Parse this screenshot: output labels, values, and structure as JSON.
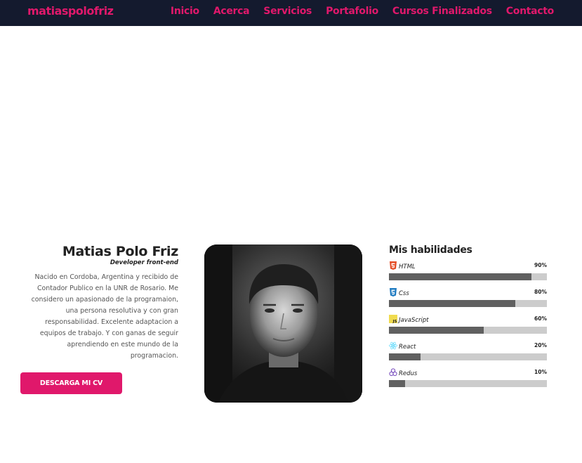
{
  "nav": {
    "brand": "matiaspolofriz",
    "links": [
      "Inicio",
      "Acerca",
      "Servicios",
      "Portafolio",
      "Cursos Finalizados",
      "Contacto"
    ]
  },
  "about": {
    "name": "Matias Polo Friz",
    "role": "Developer front-end",
    "bio": "Nacido en Cordoba, Argentina y recibido de Contador Publico en la UNR de Rosario. Me considero un apasionado de la programaion, una persona resolutiva y con gran responsabilidad. Excelente adaptacion a equipos de trabajo. Y con ganas de seguir aprendiendo en este mundo de la programacion.",
    "cv_button": "DESCARGA MI CV"
  },
  "skills": {
    "title": "Mis habilidades",
    "items": [
      {
        "name": "HTML",
        "percent": "90%",
        "value": 0.9,
        "icon": "html5-icon",
        "color": "#e44d26"
      },
      {
        "name": "Css",
        "percent": "80%",
        "value": 0.8,
        "icon": "css3-icon",
        "color": "#1f7bc1"
      },
      {
        "name": "JavaScript",
        "percent": "60%",
        "value": 0.6,
        "icon": "javascript-icon",
        "color": "#f0db4f"
      },
      {
        "name": "React",
        "percent": "20%",
        "value": 0.2,
        "icon": "react-icon",
        "color": "#61dafb"
      },
      {
        "name": "Redus",
        "percent": "10%",
        "value": 0.1,
        "icon": "redux-icon",
        "color": "#764abc"
      }
    ]
  },
  "colors": {
    "accent": "#e0186b",
    "navbar": "#141a2e"
  }
}
